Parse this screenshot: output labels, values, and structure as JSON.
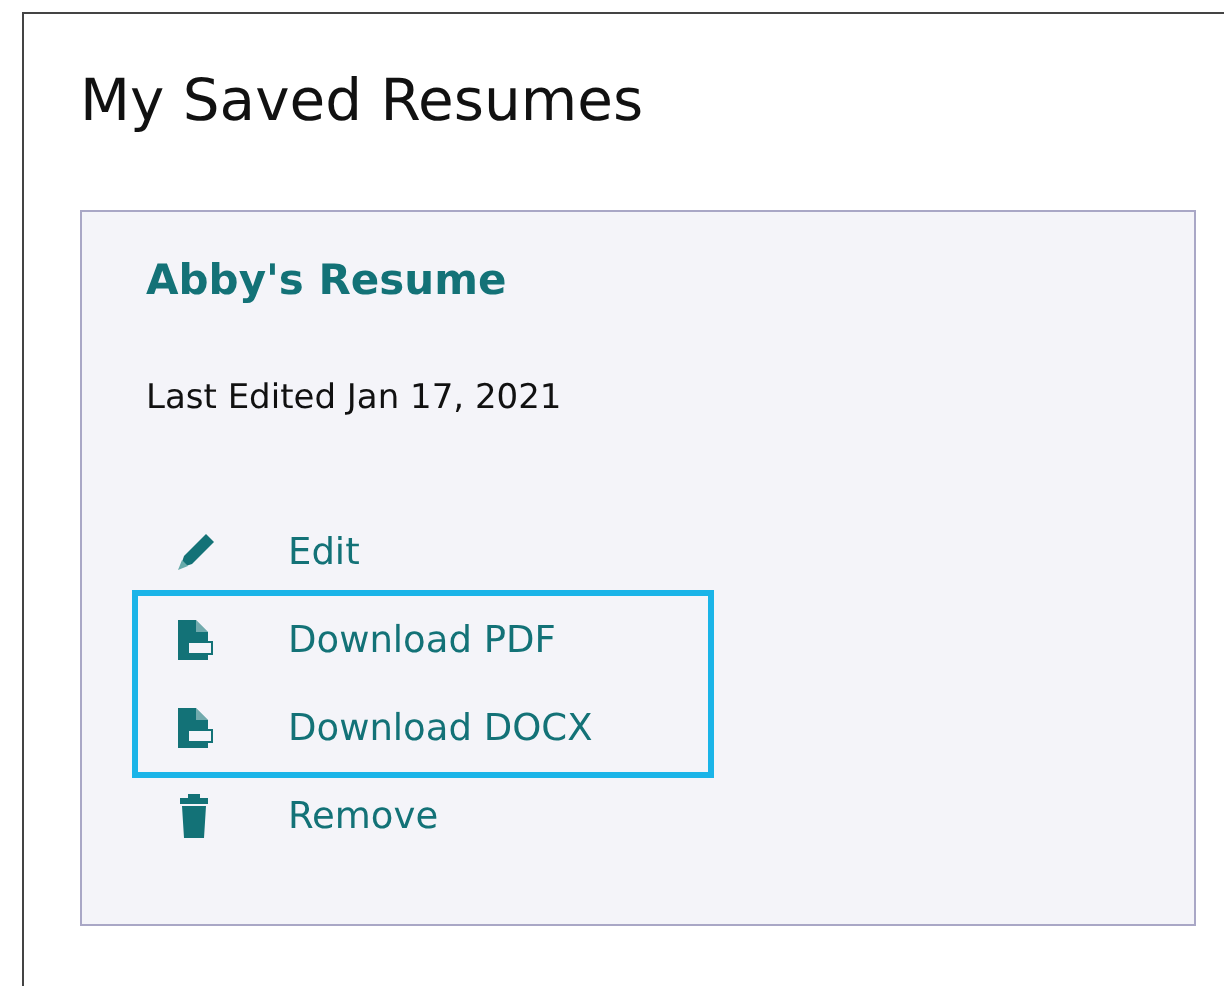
{
  "page": {
    "title": "My Saved Resumes"
  },
  "resumes": [
    {
      "name": "Abby's Resume",
      "last_edited": "Last Edited Jan 17, 2021",
      "actions": [
        {
          "kind": "edit",
          "label": "Edit",
          "highlighted": false
        },
        {
          "kind": "pdf",
          "label": "Download PDF",
          "highlighted": true
        },
        {
          "kind": "docx",
          "label": "Download DOCX",
          "highlighted": true
        },
        {
          "kind": "remove",
          "label": "Remove",
          "highlighted": false
        }
      ]
    }
  ]
}
